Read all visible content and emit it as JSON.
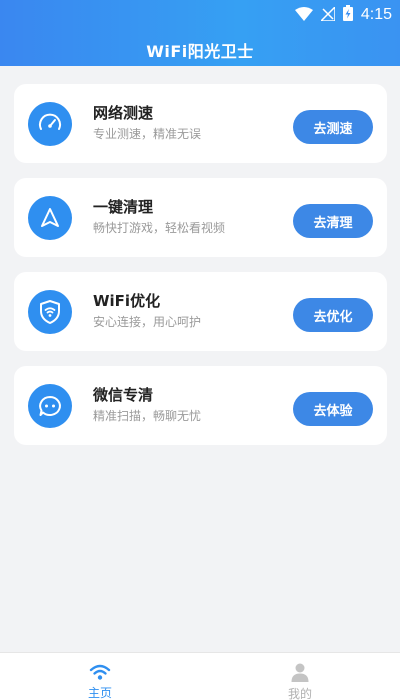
{
  "status_bar": {
    "time": "4:15"
  },
  "header": {
    "title": "WiFi阳光卫士"
  },
  "colors": {
    "accent": "#2f8ff0",
    "button": "#3d88e6",
    "header_start": "#3a87f0",
    "header_end": "#36a0f3"
  },
  "cards": [
    {
      "title": "网络测速",
      "subtitle": "专业测速，精准无误",
      "button": "去测速",
      "icon": "speedometer-icon"
    },
    {
      "title": "一键清理",
      "subtitle": "畅快打游戏，轻松看视频",
      "button": "去清理",
      "icon": "navigation-arrow-icon"
    },
    {
      "title": "WiFi优化",
      "subtitle": "安心连接，用心呵护",
      "button": "去优化",
      "icon": "wifi-shield-icon"
    },
    {
      "title": "微信专清",
      "subtitle": "精准扫描，畅聊无忧",
      "button": "去体验",
      "icon": "chat-bubble-icon"
    }
  ],
  "bottom_nav": {
    "items": [
      {
        "label": "主页",
        "icon": "wifi-icon",
        "active": true
      },
      {
        "label": "我的",
        "icon": "user-icon",
        "active": false
      }
    ]
  }
}
